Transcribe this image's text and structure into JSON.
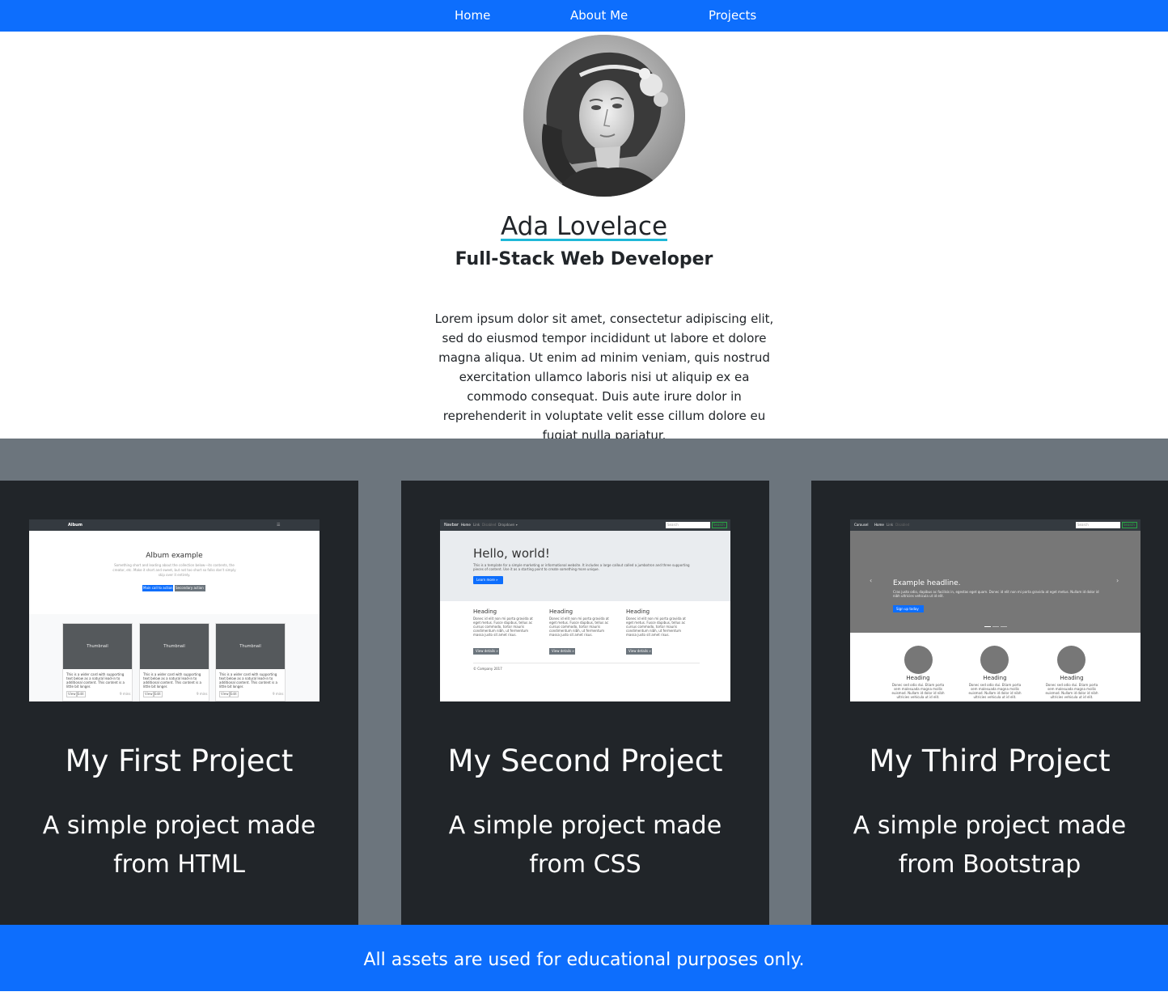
{
  "nav": {
    "items": [
      "Home",
      "About Me",
      "Projects"
    ],
    "bg": "#0d6efd"
  },
  "profile": {
    "name": "Ada Lovelace",
    "role": "Full-Stack Web Developer",
    "bio": "Lorem ipsum dolor sit amet, consectetur adipiscing elit, sed do eiusmod tempor incididunt ut labore et dolore magna aliqua. Ut enim ad minim veniam, quis nostrud exercitation ullamco laboris nisi ut aliquip ex ea commodo consequat. Duis aute irure dolor in reprehenderit in voluptate velit esse cillum dolore eu fugiat nulla pariatur."
  },
  "projects": [
    {
      "title": "My First Project",
      "description": "A simple project made from HTML",
      "thumbnail": {
        "brand": "Album",
        "heading": "Album example",
        "lead": "Something short and leading about the collection below—its contents, the creator, etc. Make it short and sweet, but not too short so folks don't simply skip over it entirely.",
        "primary_button": "Main call to action",
        "secondary_button": "Secondary action",
        "card_label": "Thumbnail",
        "card_text": "This is a wider card with supporting text below as a natural lead-in to additional content. This content is a little bit longer.",
        "view_button": "View",
        "edit_button": "Edit",
        "time": "9 mins"
      }
    },
    {
      "title": "My Second Project",
      "description": "A simple project made from CSS",
      "thumbnail": {
        "brand": "Navbar",
        "links": [
          "Home",
          "Link",
          "Disabled",
          "Dropdown ▾"
        ],
        "search_placeholder": "Search",
        "search_button": "Search",
        "heading": "Hello, world!",
        "lead": "This is a template for a simple marketing or informational website. It includes a large callout called a jumbotron and three supporting pieces of content. Use it as a starting point to create something more unique.",
        "cta": "Learn more »",
        "column_heading": "Heading",
        "column_text": "Donec id elit non mi porta gravida at eget metus. Fusce dapibus, tellus ac cursus commodo, tortor mauris condimentum nibh, ut fermentum massa justo sit amet risus.",
        "details_button": "View details »",
        "footer": "© Company 2017"
      }
    },
    {
      "title": "My Third Project",
      "description": "A simple project made from Bootstrap",
      "thumbnail": {
        "brand": "Carousel",
        "links": [
          "Home",
          "Link",
          "Disabled"
        ],
        "search_placeholder": "Search",
        "search_button": "Search",
        "headline": "Example headline.",
        "caption": "Cras justo odio, dapibus ac facilisis in, egestas eget quam. Donec id elit non mi porta gravida at eget metus. Nullam id dolor id nibh ultricies vehicula ut id elit.",
        "cta": "Sign up today",
        "column_heading": "Heading",
        "column_text": "Donec sed odio dui. Etiam porta sem malesuada magna mollis euismod. Nullam id dolor id nibh ultricies vehicula ut id elit."
      }
    }
  ],
  "footer": {
    "text": "All assets are used for educational purposes only."
  },
  "colors": {
    "primary": "#0d6efd",
    "dark": "#212529",
    "gray": "#6c757d",
    "underline": "#1fb8d8"
  }
}
